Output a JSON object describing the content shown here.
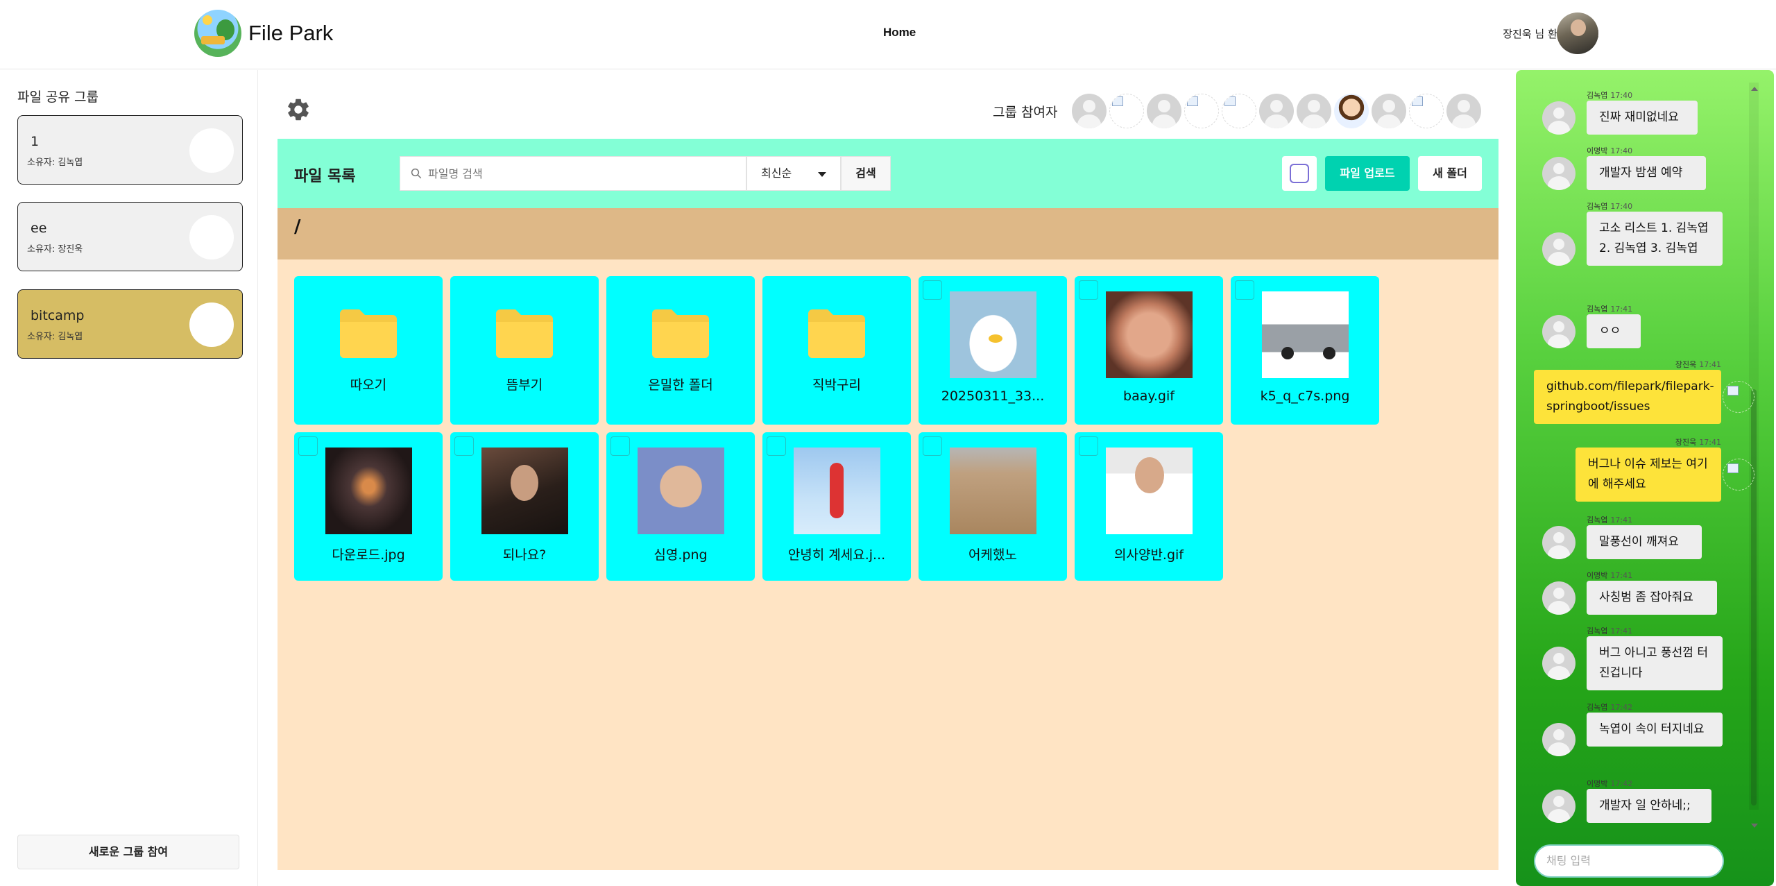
{
  "header": {
    "app_title": "File Park",
    "nav_home": "Home",
    "welcome": "장진욱 님 환영합니다!"
  },
  "sidebar": {
    "title": "파일 공유 그룹",
    "groups": [
      {
        "name": "1",
        "owner": "소유자:  김녹엽",
        "active": false
      },
      {
        "name": "ee",
        "owner": "소유자:  장진욱",
        "active": false
      },
      {
        "name": "bitcamp",
        "owner": "소유자:  김녹엽",
        "active": true
      }
    ],
    "join_label": "새로운 그룹 참여"
  },
  "main": {
    "participants_label": "그룹 참여자",
    "participants": [
      "default",
      "broken",
      "default",
      "broken",
      "broken",
      "default",
      "default",
      "cartoon",
      "default",
      "broken",
      "default"
    ],
    "toolbar": {
      "title": "파일 목록",
      "search_placeholder": "파일명 검색",
      "sort_value": "최신순",
      "search_label": "검색",
      "upload_label": "파일 업로드",
      "new_folder_label": "새 폴더"
    },
    "path": "/",
    "files": [
      {
        "name": "따오기",
        "type": "folder"
      },
      {
        "name": "뜸부기",
        "type": "folder"
      },
      {
        "name": "은밀한 폴더",
        "type": "folder"
      },
      {
        "name": "직박구리",
        "type": "folder"
      },
      {
        "name": "20250311_33...",
        "type": "image",
        "thumb": "t-duck"
      },
      {
        "name": "baay.gif",
        "type": "image",
        "thumb": "t-baby"
      },
      {
        "name": "k5_q_c7s.png",
        "type": "image",
        "thumb": "t-car"
      },
      {
        "name": "다운로드.jpg",
        "type": "image",
        "thumb": "t-dark"
      },
      {
        "name": "되나요?",
        "type": "image",
        "thumb": "t-actor"
      },
      {
        "name": "심영.png",
        "type": "image",
        "thumb": "t-man"
      },
      {
        "name": "안녕히 계세요.j...",
        "type": "image",
        "thumb": "t-sky"
      },
      {
        "name": "어케했노",
        "type": "image",
        "thumb": "t-sign"
      },
      {
        "name": "의사양반.gif",
        "type": "image",
        "thumb": "t-doctor"
      }
    ]
  },
  "chat": {
    "messages": [
      {
        "sender": "김녹엽",
        "time": "17:40",
        "text": "진짜 재미없네요",
        "mine": false
      },
      {
        "sender": "이명박",
        "time": "17:40",
        "text": "개발자 밤샘 예약",
        "mine": false
      },
      {
        "sender": "김녹엽",
        "time": "17:40",
        "text": "고소 리스트 1. 김녹엽 2. 김녹엽 3. 김녹엽",
        "mine": false
      },
      {
        "sender": "김녹엽",
        "time": "17:41",
        "text": "ㅇㅇ",
        "mine": false
      },
      {
        "sender": "장진욱",
        "time": "17:41",
        "text": "github.com/filepark/filepark-springboot/issues",
        "mine": true
      },
      {
        "sender": "장진욱",
        "time": "17:41",
        "text": "버그나 이슈 제보는 여기에 해주세요",
        "mine": true
      },
      {
        "sender": "김녹엽",
        "time": "17:41",
        "text": "말풍선이 깨져요",
        "mine": false
      },
      {
        "sender": "이명박",
        "time": "17:41",
        "text": "사칭범 좀 잡아줘요",
        "mine": false
      },
      {
        "sender": "김녹엽",
        "time": "17:41",
        "text": "버그 아니고 풍선껌 터진겁니다",
        "mine": false
      },
      {
        "sender": "김녹엽",
        "time": "17:42",
        "text": "녹엽이 속이 터지네요",
        "mine": false
      },
      {
        "sender": "이명박",
        "time": "17:42",
        "text": "개발자 일 안하네;;",
        "mine": false
      }
    ],
    "input_placeholder": "채팅 입력"
  },
  "colors": {
    "toolbar_bg": "#83ffd6",
    "path_bg": "#deb887",
    "file_area_bg": "#ffe4c4",
    "tile_bg": "#00ffff",
    "upload_button": "#00d2b0",
    "active_group": "#d6bd64",
    "chat_gradient_top": "#95f26a",
    "chat_gradient_bottom": "#16921a",
    "my_bubble": "#fde33a"
  }
}
